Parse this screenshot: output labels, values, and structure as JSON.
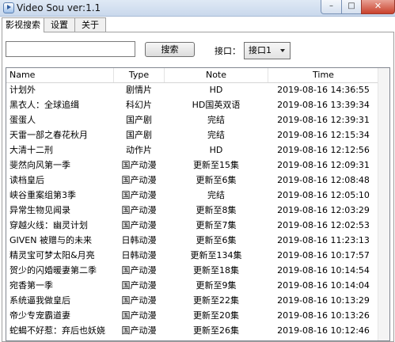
{
  "window": {
    "title": "Video Sou  ver:1.1",
    "min_glyph": "–",
    "max_glyph": "□",
    "close_glyph": "✕"
  },
  "tabs": [
    {
      "label": "影视搜索",
      "active": true
    },
    {
      "label": "设置",
      "active": false
    },
    {
      "label": "关于",
      "active": false
    }
  ],
  "search": {
    "value": "",
    "placeholder": "",
    "button_label": "搜索"
  },
  "api": {
    "label": "接口：",
    "selected": "接口1"
  },
  "table": {
    "columns": [
      "Name",
      "Type",
      "Note",
      "Time"
    ],
    "rows": [
      {
        "name": "计划外",
        "type": "剧情片",
        "note": "HD",
        "time": "2019-08-16 14:36:55"
      },
      {
        "name": "黑衣人：全球追缉",
        "type": "科幻片",
        "note": "HD国英双语",
        "time": "2019-08-16 13:39:34"
      },
      {
        "name": "蛋蛋人",
        "type": "国产剧",
        "note": "完结",
        "time": "2019-08-16 12:39:31"
      },
      {
        "name": "天雷一部之春花秋月",
        "type": "国产剧",
        "note": "完结",
        "time": "2019-08-16 12:15:34"
      },
      {
        "name": "大清十二刑",
        "type": "动作片",
        "note": "HD",
        "time": "2019-08-16 12:12:56"
      },
      {
        "name": "斐然向风第一季",
        "type": "国产动漫",
        "note": "更新至15集",
        "time": "2019-08-16 12:09:31"
      },
      {
        "name": "读档皇后",
        "type": "国产动漫",
        "note": "更新至6集",
        "time": "2019-08-16 12:08:48"
      },
      {
        "name": "峡谷重案组第3季",
        "type": "国产动漫",
        "note": "完结",
        "time": "2019-08-16 12:05:10"
      },
      {
        "name": "异常生物见闻录",
        "type": "国产动漫",
        "note": "更新至8集",
        "time": "2019-08-16 12:03:29"
      },
      {
        "name": "穿越火线：幽灵计划",
        "type": "国产动漫",
        "note": "更新至7集",
        "time": "2019-08-16 12:02:53"
      },
      {
        "name": "GIVEN 被赠与的未来",
        "type": "日韩动漫",
        "note": "更新至6集",
        "time": "2019-08-16 11:23:13"
      },
      {
        "name": "精灵宝可梦太阳&月亮",
        "type": "日韩动漫",
        "note": "更新至134集",
        "time": "2019-08-16 10:17:57"
      },
      {
        "name": "贺少的闪婚暖妻第二季",
        "type": "国产动漫",
        "note": "更新至18集",
        "time": "2019-08-16 10:14:54"
      },
      {
        "name": "宛香第一季",
        "type": "国产动漫",
        "note": "更新至9集",
        "time": "2019-08-16 10:14:04"
      },
      {
        "name": "系统逼我做皇后",
        "type": "国产动漫",
        "note": "更新至22集",
        "time": "2019-08-16 10:13:29"
      },
      {
        "name": "帝少专宠霸道妻",
        "type": "国产动漫",
        "note": "更新至20集",
        "time": "2019-08-16 10:13:26"
      },
      {
        "name": "蛇蝎不好惹：弃后也妖娆",
        "type": "国产动漫",
        "note": "更新至26集",
        "time": "2019-08-16 10:12:46"
      }
    ]
  }
}
